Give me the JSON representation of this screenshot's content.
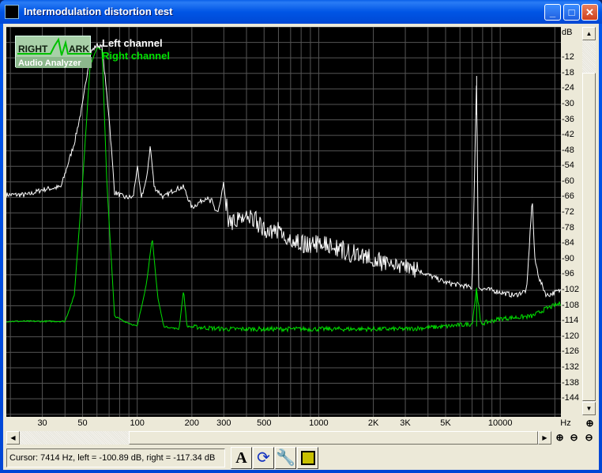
{
  "window": {
    "title": "Intermodulation distortion test",
    "minimize": "_",
    "maximize": "□",
    "close": "✕"
  },
  "logo": {
    "line1_left": "RIGHT",
    "line1_right": "ARK",
    "line2": "Audio Analyzer"
  },
  "legend": [
    {
      "label": "Left channel",
      "color": "#ffffff"
    },
    {
      "label": "Right channel",
      "color": "#00e000"
    }
  ],
  "y_axis": {
    "unit": "dB",
    "ticks": [
      "-12",
      "-18",
      "-24",
      "-30",
      "-36",
      "-42",
      "-48",
      "-54",
      "-60",
      "-66",
      "-72",
      "-78",
      "-84",
      "-90",
      "-96",
      "-102",
      "-108",
      "-114",
      "-120",
      "-126",
      "-132",
      "-138",
      "-144"
    ]
  },
  "x_axis": {
    "unit": "Hz",
    "ticks": [
      {
        "f": 30,
        "label": "30"
      },
      {
        "f": 50,
        "label": "50"
      },
      {
        "f": 100,
        "label": "100"
      },
      {
        "f": 200,
        "label": "200"
      },
      {
        "f": 300,
        "label": "300"
      },
      {
        "f": 500,
        "label": "500"
      },
      {
        "f": 1000,
        "label": "1000"
      },
      {
        "f": 2000,
        "label": "2K"
      },
      {
        "f": 3000,
        "label": "3K"
      },
      {
        "f": 5000,
        "label": "5K"
      },
      {
        "f": 10000,
        "label": "10000"
      }
    ]
  },
  "status": {
    "cursor": "Cursor:  7414 Hz,  left = -100.89 dB,  right = -117.34 dB"
  },
  "toolbar": {
    "font": "A",
    "refresh": "refresh",
    "settings": "settings",
    "save": "save"
  },
  "chart_data": {
    "type": "line",
    "xlabel": "Hz",
    "ylabel": "dB",
    "xscale": "log",
    "xlim": [
      19,
      21600
    ],
    "ylim": [
      -151,
      0
    ],
    "series": [
      {
        "name": "Left channel",
        "color": "#ffffff",
        "points": [
          [
            19,
            -65
          ],
          [
            25,
            -65
          ],
          [
            30,
            -63
          ],
          [
            38,
            -62
          ],
          [
            45,
            -45
          ],
          [
            50,
            -30
          ],
          [
            55,
            -10
          ],
          [
            60,
            -7
          ],
          [
            64,
            -8
          ],
          [
            70,
            -35
          ],
          [
            75,
            -64
          ],
          [
            85,
            -66
          ],
          [
            95,
            -66
          ],
          [
            100,
            -54
          ],
          [
            105,
            -66
          ],
          [
            112,
            -60
          ],
          [
            118,
            -46
          ],
          [
            124,
            -62
          ],
          [
            140,
            -66
          ],
          [
            160,
            -63
          ],
          [
            180,
            -62
          ],
          [
            200,
            -70
          ],
          [
            240,
            -66
          ],
          [
            280,
            -72
          ],
          [
            300,
            -62
          ],
          [
            320,
            -76
          ],
          [
            400,
            -72
          ],
          [
            500,
            -78
          ],
          [
            600,
            -79
          ],
          [
            800,
            -84
          ],
          [
            1000,
            -84
          ],
          [
            1300,
            -86
          ],
          [
            1600,
            -88
          ],
          [
            2000,
            -90
          ],
          [
            2500,
            -92
          ],
          [
            3000,
            -92
          ],
          [
            4000,
            -96
          ],
          [
            5000,
            -99
          ],
          [
            6000,
            -100
          ],
          [
            7000,
            -101
          ],
          [
            7414,
            -19
          ],
          [
            7600,
            -101
          ],
          [
            9000,
            -102
          ],
          [
            12000,
            -104
          ],
          [
            14000,
            -102
          ],
          [
            15000,
            -66
          ],
          [
            15500,
            -90
          ],
          [
            16500,
            -98
          ],
          [
            18000,
            -104
          ],
          [
            21600,
            -102
          ]
        ]
      },
      {
        "name": "Right channel",
        "color": "#00e000",
        "points": [
          [
            19,
            -114
          ],
          [
            30,
            -114
          ],
          [
            40,
            -114
          ],
          [
            45,
            -104
          ],
          [
            50,
            -60
          ],
          [
            55,
            -15
          ],
          [
            60,
            -8
          ],
          [
            64,
            -9
          ],
          [
            68,
            -60
          ],
          [
            75,
            -112
          ],
          [
            85,
            -114
          ],
          [
            100,
            -116
          ],
          [
            112,
            -100
          ],
          [
            121,
            -82
          ],
          [
            130,
            -105
          ],
          [
            140,
            -116
          ],
          [
            170,
            -117
          ],
          [
            180,
            -102
          ],
          [
            188,
            -116
          ],
          [
            300,
            -117
          ],
          [
            1000,
            -117
          ],
          [
            3000,
            -117
          ],
          [
            5000,
            -116
          ],
          [
            7000,
            -115
          ],
          [
            7414,
            -101
          ],
          [
            7800,
            -115
          ],
          [
            10000,
            -113
          ],
          [
            15000,
            -112
          ],
          [
            18000,
            -109
          ],
          [
            21600,
            -107
          ]
        ]
      }
    ]
  }
}
